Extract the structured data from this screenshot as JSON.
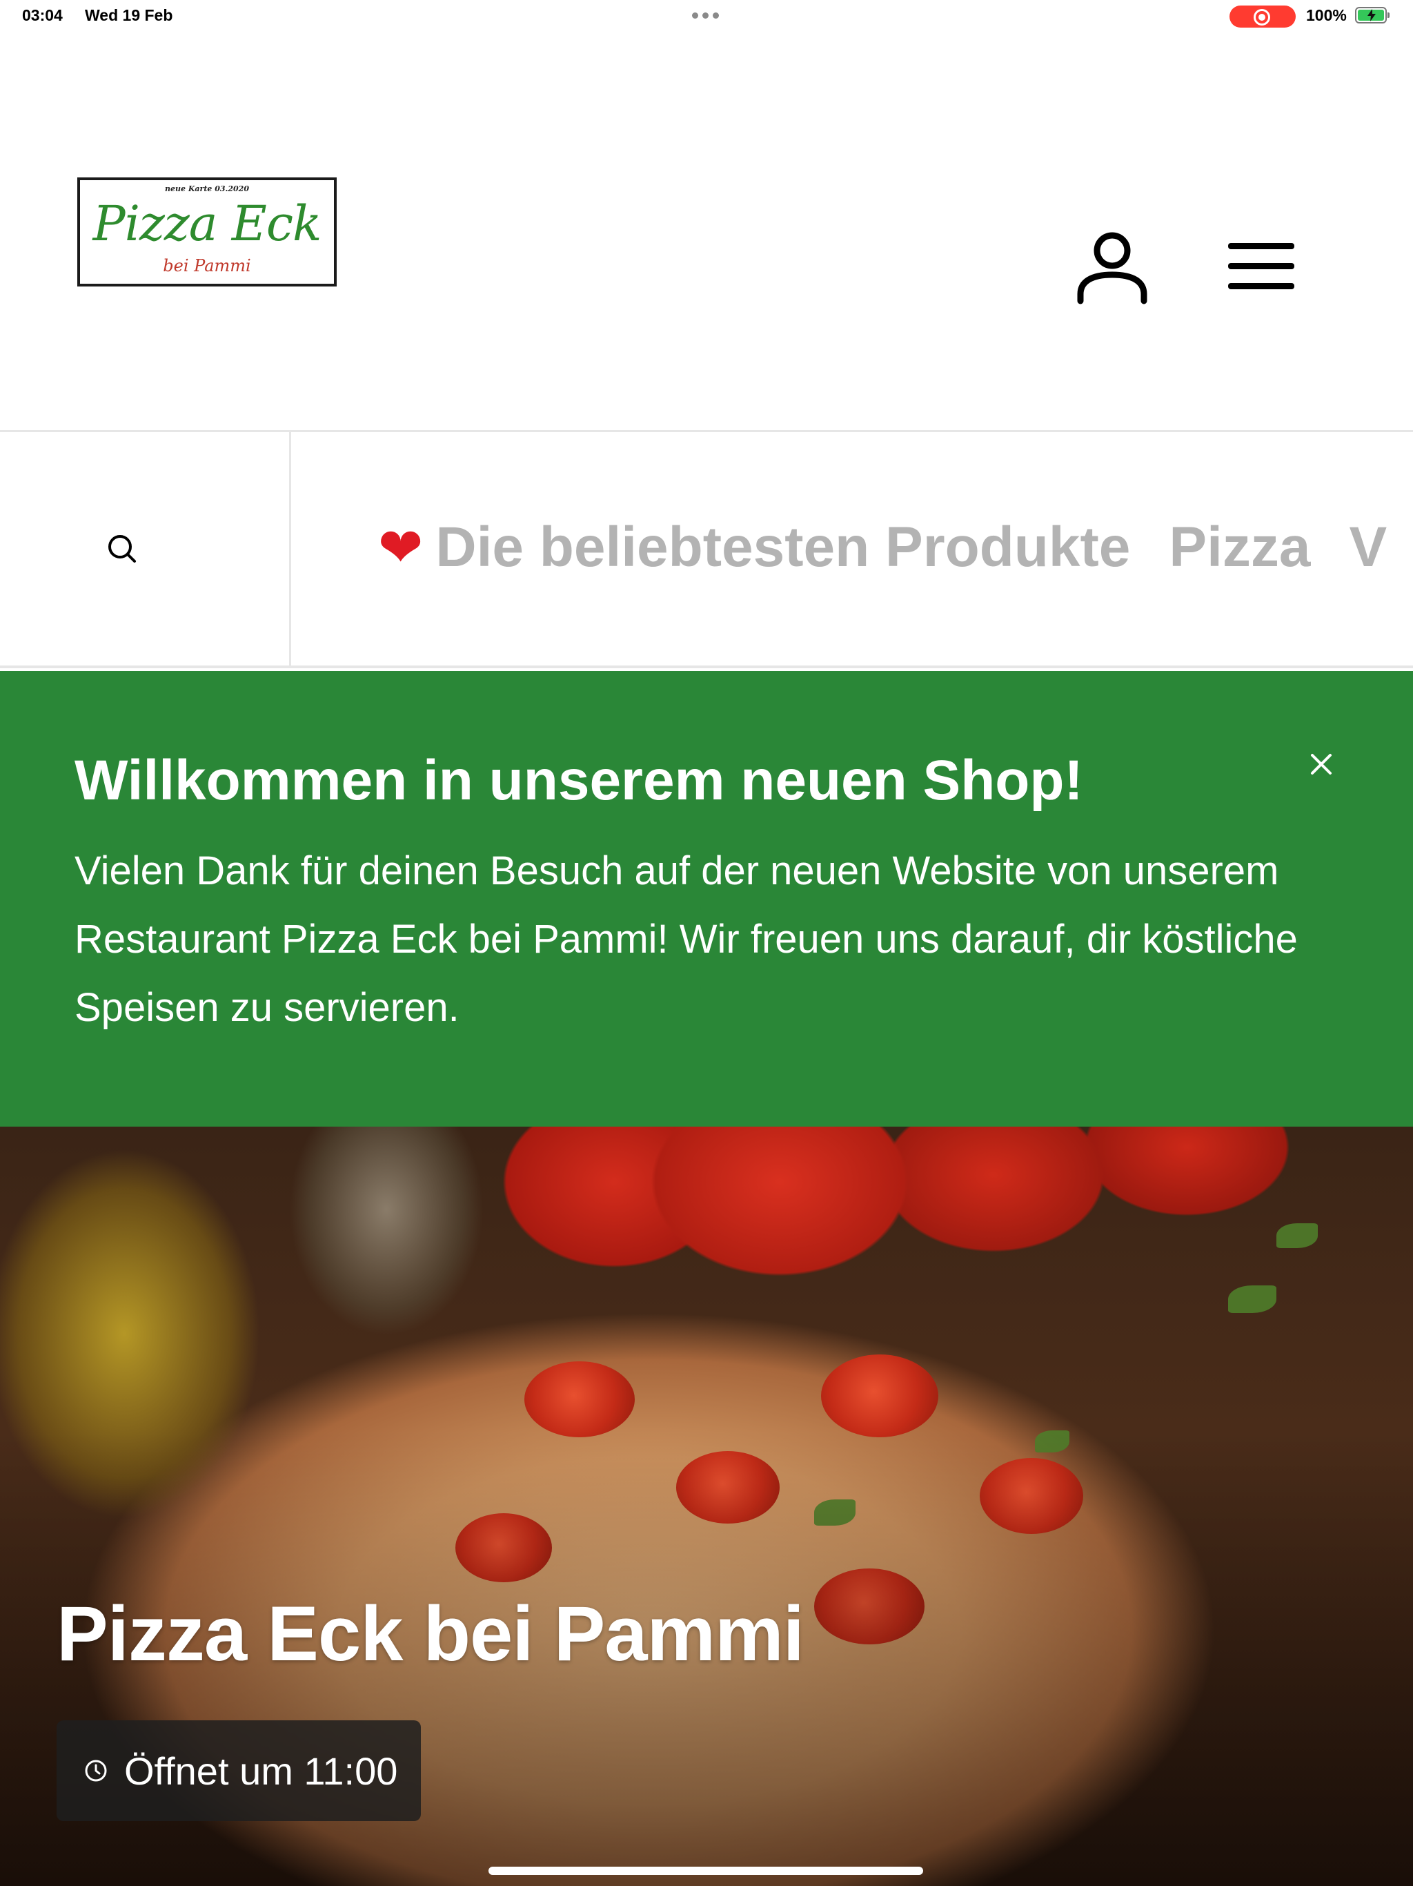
{
  "status_bar": {
    "time": "03:04",
    "date": "Wed 19 Feb",
    "battery": "100%"
  },
  "header": {
    "logo": {
      "top_text": "neue Karte 03.2020",
      "name": "Pizza Eck",
      "sub": "bei Pammi"
    },
    "icons": [
      "user-icon",
      "menu-icon"
    ]
  },
  "nav": {
    "items": [
      {
        "label": "Die beliebtesten Produkte",
        "icon": "heart"
      },
      {
        "label": "Pizza"
      },
      {
        "label": "V"
      }
    ]
  },
  "banner": {
    "title": "Willkommen in unserem neuen Shop!",
    "text": "Vielen Dank für deinen Besuch auf der neuen Website von unserem Restaurant Pizza Eck bei Pammi! Wir freuen uns darauf, dir köstliche Speisen zu servieren.",
    "background": "#2a8737"
  },
  "hero": {
    "title": "Pizza Eck bei Pammi",
    "hours": "Öffnet um 11:00"
  },
  "colors": {
    "brand_green": "#2a8737",
    "nav_text": "#b3b3b3",
    "heart": "#e01b24"
  }
}
